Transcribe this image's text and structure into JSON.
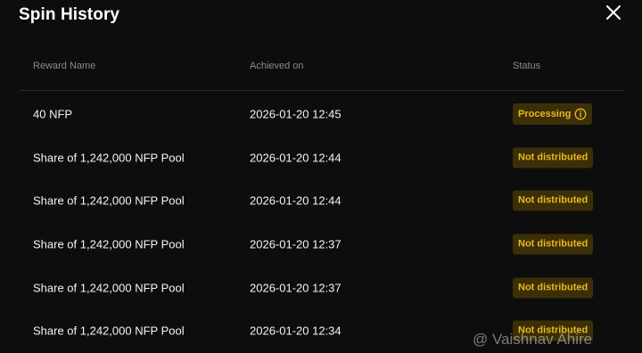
{
  "dialog": {
    "title": "Spin History"
  },
  "table": {
    "columns": [
      "Reward Name",
      "Achieved on",
      "Status"
    ],
    "rows": [
      {
        "reward": "40 NFP",
        "achieved": "2026-01-20 12:45",
        "status": "Processing",
        "status_icon": "info-icon"
      },
      {
        "reward": "Share of 1,242,000 NFP Pool",
        "achieved": "2026-01-20 12:44",
        "status": "Not distributed"
      },
      {
        "reward": "Share of 1,242,000 NFP Pool",
        "achieved": "2026-01-20 12:44",
        "status": "Not distributed"
      },
      {
        "reward": "Share of 1,242,000 NFP Pool",
        "achieved": "2026-01-20 12:37",
        "status": "Not distributed"
      },
      {
        "reward": "Share of 1,242,000 NFP Pool",
        "achieved": "2026-01-20 12:37",
        "status": "Not distributed"
      },
      {
        "reward": "Share of 1,242,000 NFP Pool",
        "achieved": "2026-01-20 12:34",
        "status": "Not distributed"
      }
    ]
  },
  "watermark": "@ Vaishnav Ahire",
  "colors": {
    "background": "#0d0d0d",
    "badge_bg": "#3b2f08",
    "badge_text": "#e9b821",
    "header_text": "#8a8a8a"
  }
}
